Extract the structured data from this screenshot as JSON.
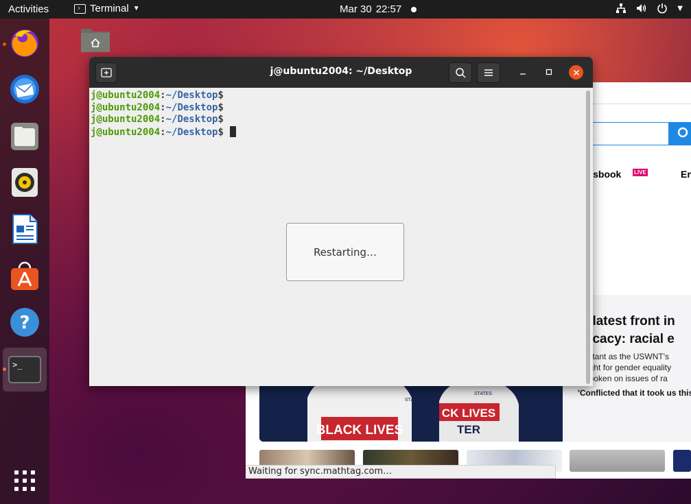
{
  "topbar": {
    "activities": "Activities",
    "app_name": "Terminal",
    "date": "Mar 30",
    "time": "22:57"
  },
  "dock": {
    "apps": [
      "firefox-icon",
      "thunderbird-icon",
      "files-icon",
      "rhythmbox-icon",
      "libreoffice-writer-icon",
      "ubuntu-software-icon",
      "help-icon",
      "terminal-icon"
    ],
    "running": [
      "firefox",
      "terminal"
    ],
    "accent": "#e95420"
  },
  "terminal": {
    "title": "j@ubuntu2004: ~/Desktop",
    "prompt_user": "j@ubuntu2004",
    "prompt_sep": ":",
    "prompt_path": "~/Desktop",
    "prompt_dollar": "$",
    "dialog_text": "Restarting…",
    "colors": {
      "user": "#4e9a06",
      "path": "#3465a4",
      "close": "#e95420"
    }
  },
  "browser": {
    "nav_sportsbook": "rtsbook",
    "live_badge": "LIVE",
    "nav_en": "En",
    "headline_1": "he latest front in",
    "headline_2": "lvocacy: racial e",
    "body_1": "mportant as the USWNT's",
    "body_2": "he fight for gender equality",
    "body_3": "outspoken on issues of ra",
    "quote": "'Conflicted that it took us this",
    "status": "Waiting for sync.mathtag.com…",
    "jersey_1": "BLACK LIVES",
    "jersey_2a": "CK LIVES",
    "jersey_2b": "TER",
    "jersey_brand": "STATES",
    "search_color": "#1e88e5"
  },
  "desktop": {
    "home_label": "Home"
  }
}
